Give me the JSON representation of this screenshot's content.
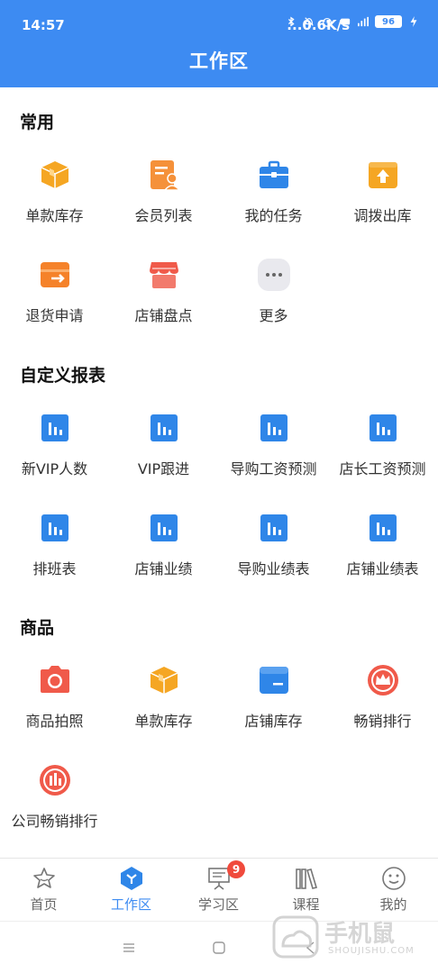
{
  "status_bar": {
    "time": "14:57",
    "network_speed": "...0.6K/s",
    "battery": "96"
  },
  "header": {
    "title": "工作区"
  },
  "sections": [
    {
      "title": "常用",
      "items": [
        {
          "label": "单款库存",
          "icon": "box-icon"
        },
        {
          "label": "会员列表",
          "icon": "member-list-icon"
        },
        {
          "label": "我的任务",
          "icon": "briefcase-icon"
        },
        {
          "label": "调拨出库",
          "icon": "transfer-out-icon"
        },
        {
          "label": "退货申请",
          "icon": "return-icon"
        },
        {
          "label": "店铺盘点",
          "icon": "store-icon"
        },
        {
          "label": "更多",
          "icon": "more-icon"
        }
      ]
    },
    {
      "title": "自定义报表",
      "items": [
        {
          "label": "新VIP人数",
          "icon": "bar-chart-icon"
        },
        {
          "label": "VIP跟进",
          "icon": "bar-chart-icon"
        },
        {
          "label": "导购工资预测",
          "icon": "bar-chart-icon"
        },
        {
          "label": "店长工资预测",
          "icon": "bar-chart-icon"
        },
        {
          "label": "排班表",
          "icon": "bar-chart-icon"
        },
        {
          "label": "店铺业绩",
          "icon": "bar-chart-icon"
        },
        {
          "label": "导购业绩表",
          "icon": "bar-chart-icon"
        },
        {
          "label": "店铺业绩表",
          "icon": "bar-chart-icon"
        }
      ]
    },
    {
      "title": "商品",
      "items": [
        {
          "label": "商品拍照",
          "icon": "camera-icon"
        },
        {
          "label": "单款库存",
          "icon": "box-icon"
        },
        {
          "label": "店铺库存",
          "icon": "folder-icon"
        },
        {
          "label": "畅销排行",
          "icon": "crown-icon"
        },
        {
          "label": "公司畅销排行",
          "icon": "ranking-chart-icon"
        }
      ]
    }
  ],
  "tabbar": {
    "tabs": [
      {
        "label": "首页",
        "icon": "star-icon"
      },
      {
        "label": "工作区",
        "icon": "workspace-icon"
      },
      {
        "label": "学习区",
        "icon": "presentation-icon",
        "badge": "9"
      },
      {
        "label": "课程",
        "icon": "books-icon"
      },
      {
        "label": "我的",
        "icon": "smiley-icon"
      }
    ],
    "active": 1
  },
  "watermark": {
    "text": "手机鼠",
    "sub": "SHOUJISHU.COM"
  },
  "colors": {
    "primary": "#3d8bf2",
    "orange": "#f5a623",
    "red": "#f05a4a"
  }
}
